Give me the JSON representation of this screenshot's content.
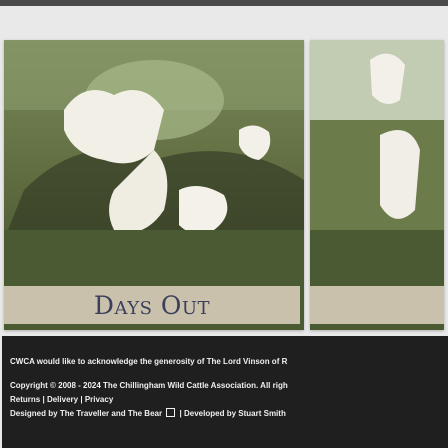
{
  "main": {
    "caption": "Days Out"
  },
  "footer": {
    "acknowledgement": "CWCA would like to acknowledge the generosity of The Lord Vinson of R",
    "copyright": "Copyright © 2008 - 2024 The Chillingham Wild Cattle Association. All righ",
    "links": [
      {
        "label": "Returns"
      },
      {
        "label": "Delivery"
      },
      {
        "label": "Privacy"
      }
    ],
    "credits_prefix": "Designed by",
    "designer": "The Traveller and The Bear",
    "developed_prefix": "| Developed by",
    "developer": "Stuart Smith"
  },
  "colors": {
    "footer_bg": "#1f1f1f",
    "caption_bg": "#c9c1ac",
    "caption_text": "#3b3f5c"
  },
  "icons": [
    "external-link-icon"
  ]
}
